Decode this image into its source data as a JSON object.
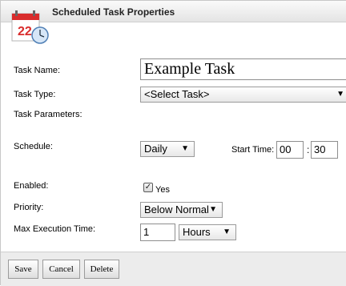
{
  "dialog": {
    "title": "Scheduled Task Properties",
    "icon": "calendar-clock-icon"
  },
  "form": {
    "task_name_label": "Task Name:",
    "task_name_value": "Example Task",
    "task_type_label": "Task Type:",
    "task_type_value": "<Select Task>",
    "task_parameters_label": "Task Parameters:",
    "schedule_label": "Schedule:",
    "schedule_value": "Daily",
    "start_time_label": "Start Time:",
    "start_hour": "00",
    "time_separator": ":",
    "start_minute": "30",
    "enabled_label": "Enabled:",
    "enabled_checked": true,
    "enabled_option_label": "Yes",
    "priority_label": "Priority:",
    "priority_value": "Below Normal",
    "max_exec_label": "Max Execution Time:",
    "max_exec_value": "1",
    "max_exec_unit": "Hours"
  },
  "buttons": {
    "save": "Save",
    "cancel": "Cancel",
    "delete": "Delete"
  }
}
